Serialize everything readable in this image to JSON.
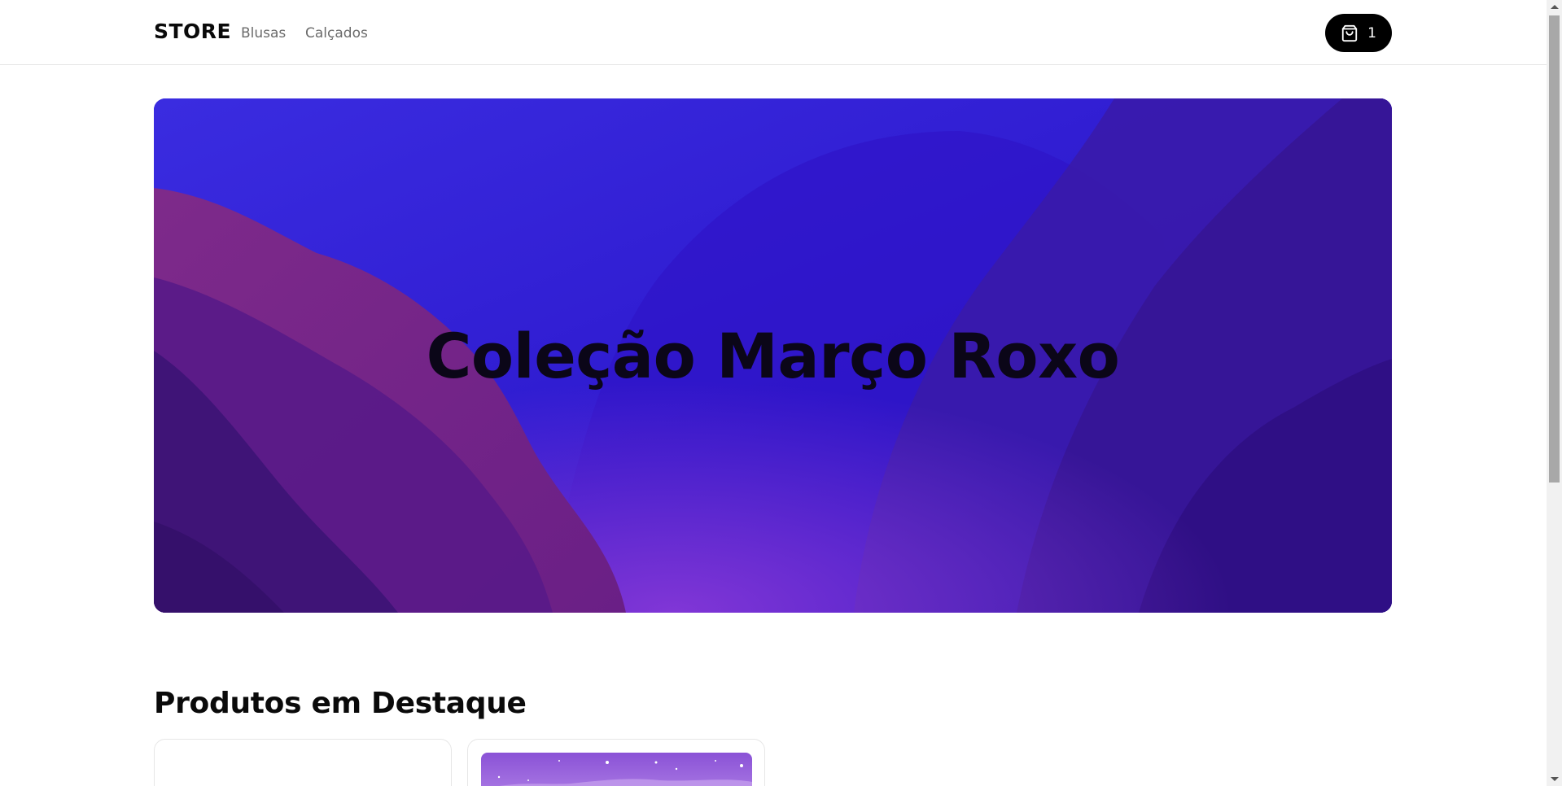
{
  "header": {
    "brand": "STORE",
    "nav": [
      {
        "label": "Blusas"
      },
      {
        "label": "Calçados"
      }
    ],
    "cart": {
      "icon": "shopping-bag-icon",
      "count": "1"
    }
  },
  "hero": {
    "title": "Coleção Março Roxo",
    "colors": {
      "base": "#2d1cc9",
      "magenta": "#7a1f7a",
      "deep": "#2b0f6e"
    }
  },
  "featured": {
    "title": "Produtos em Destaque"
  },
  "scrollbar": {
    "up_icon": "scroll-up-arrow-icon",
    "down_icon": "scroll-down-arrow-icon"
  }
}
